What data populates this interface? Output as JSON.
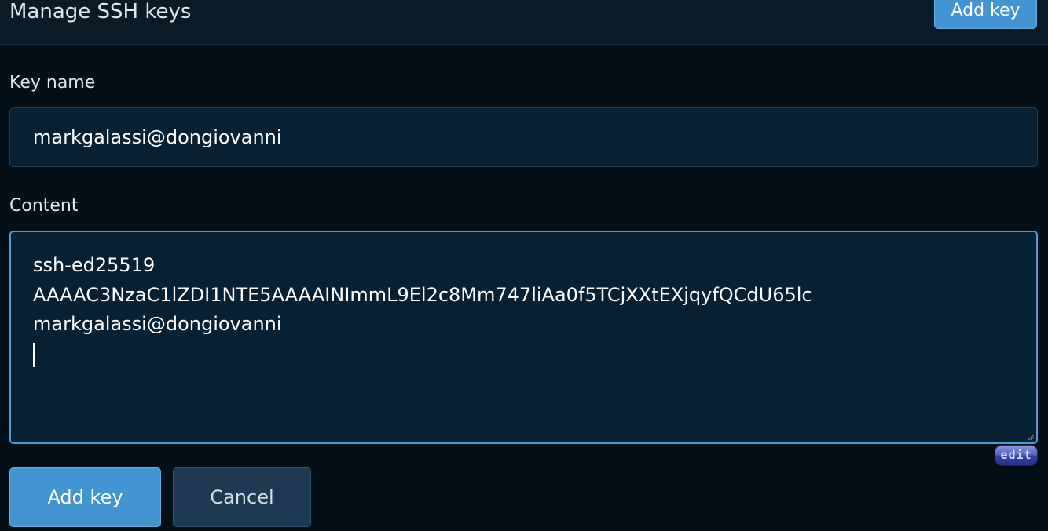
{
  "header": {
    "title": "Manage SSH keys",
    "add_key_label": "Add key"
  },
  "form": {
    "key_name": {
      "label": "Key name",
      "value": "markgalassi@dongiovanni"
    },
    "content": {
      "label": "Content",
      "lines": [
        "ssh-ed25519",
        "AAAAC3NzaC1lZDI1NTE5AAAAINImmL9El2c8Mm747liAa0f5TCjXXtEXjqyfQCdU65lc",
        "markgalassi@dongiovanni"
      ]
    },
    "edit_badge": "edit",
    "submit_label": "Add key",
    "cancel_label": "Cancel"
  },
  "colors": {
    "background": "#050f17",
    "header_background": "#0a1a26",
    "field_background": "#082033",
    "focus_border": "#4d9ad6",
    "primary_button": "#4295d1",
    "secondary_button": "#1e3a52"
  }
}
